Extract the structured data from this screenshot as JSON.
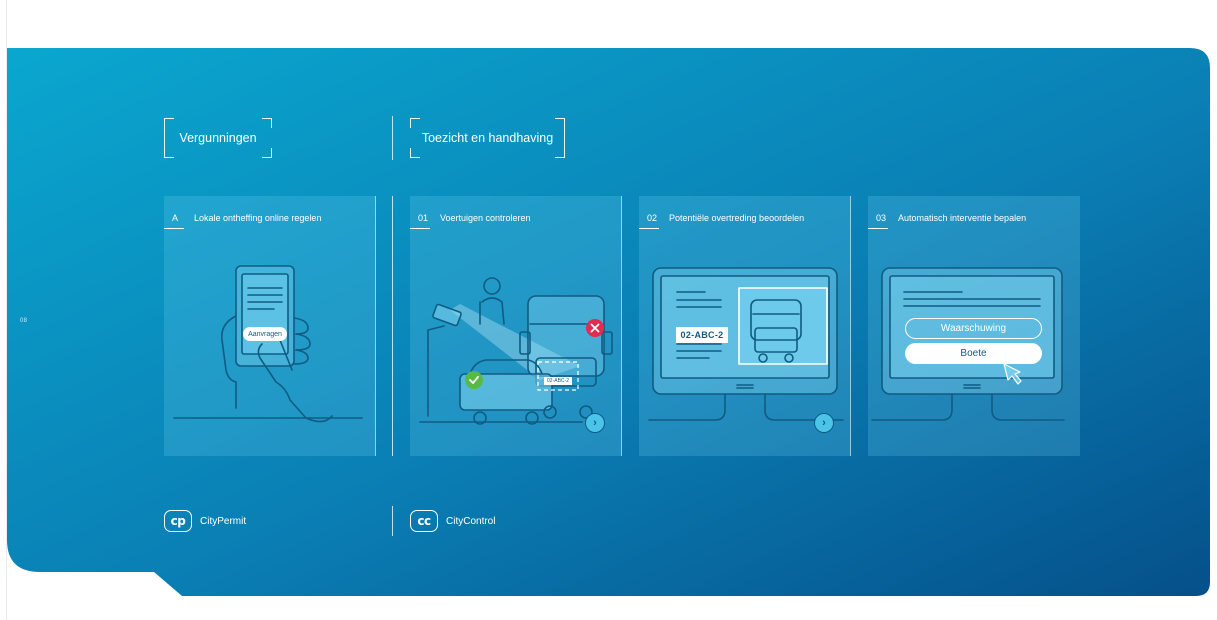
{
  "page_number": "08",
  "sections": {
    "permits": "Vergunningen",
    "enforcement": "Toezicht en handhaving"
  },
  "cards": [
    {
      "step": "A",
      "title": "Lokale ontheffing online regelen"
    },
    {
      "step": "01",
      "title": "Voertuigen controleren"
    },
    {
      "step": "02",
      "title": "Potentiële overtreding beoordelen"
    },
    {
      "step": "03",
      "title": "Automatisch interventie bepalen"
    }
  ],
  "phone_button": "Aanvragen",
  "small_plate": "02-ABC-2",
  "plate": "02-ABC-2",
  "actions": {
    "warning": "Waarschuwing",
    "fine": "Boete"
  },
  "brands": {
    "permit_mark": "cp",
    "permit_name": "CityPermit",
    "control_mark": "cc",
    "control_name": "CityControl"
  },
  "colors": {
    "gradient_start": "#0aa7cf",
    "gradient_end": "#05508a",
    "line_art": "#0f5c83",
    "approved": "#58b947",
    "rejected": "#e02c4e"
  }
}
